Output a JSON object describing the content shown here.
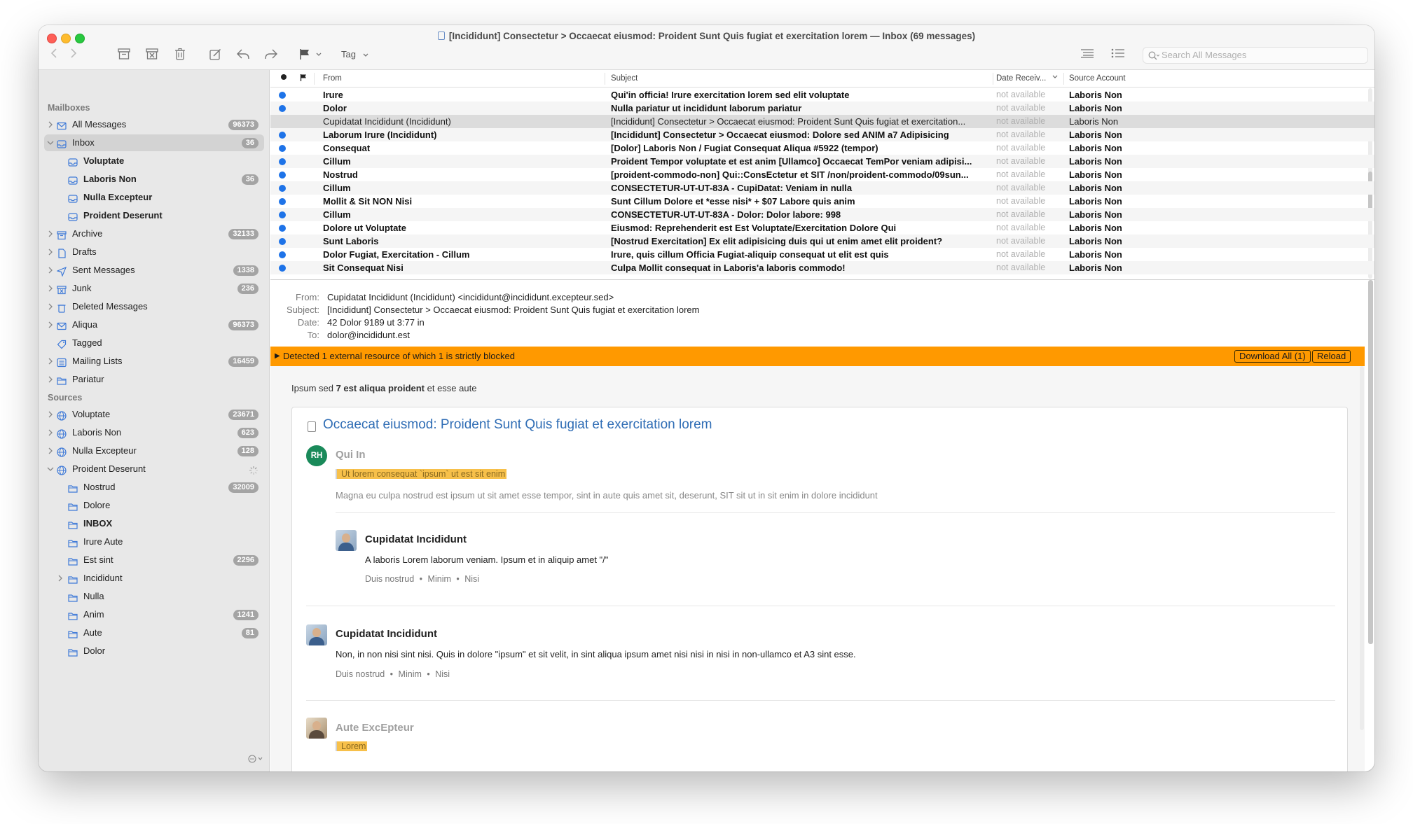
{
  "window": {
    "title": "[Incididunt] Consectetur > Occaecat eiusmod: Proident Sunt Quis fugiat et exercitation lorem — Inbox (69 messages)"
  },
  "toolbar": {
    "tag_label": "Tag",
    "search_placeholder": "Search All Messages",
    "icons": [
      "back-icon",
      "forward-icon",
      "archive-icon",
      "junk-icon",
      "trash-icon",
      "compose-icon",
      "reply-icon",
      "forward-arrow-icon",
      "flag-icon",
      "chevron-down-icon",
      "list-compact-icon",
      "list-icon",
      "search-icon"
    ]
  },
  "sidebar": {
    "mailboxes_header": "Mailboxes",
    "sources_header": "Sources",
    "mailboxes": [
      {
        "label": "All Messages",
        "badge": "96373",
        "icon": "envelope-icon",
        "chev": "right",
        "bold": false,
        "indent": 0
      },
      {
        "label": "Inbox",
        "badge": "36",
        "icon": "inbox-icon",
        "chev": "down",
        "bold": false,
        "indent": 0,
        "selected": true
      },
      {
        "label": "Voluptate",
        "badge": "",
        "icon": "inbox-icon",
        "chev": "",
        "bold": true,
        "indent": 1
      },
      {
        "label": "Laboris Non",
        "badge": "36",
        "icon": "inbox-icon",
        "chev": "",
        "bold": true,
        "indent": 1
      },
      {
        "label": "Nulla Excepteur",
        "badge": "",
        "icon": "inbox-icon",
        "chev": "",
        "bold": true,
        "indent": 1
      },
      {
        "label": "Proident Deserunt",
        "badge": "",
        "icon": "inbox-icon",
        "chev": "",
        "bold": true,
        "indent": 1
      },
      {
        "label": "Archive",
        "badge": "32133",
        "icon": "archive-icon",
        "chev": "right",
        "bold": false,
        "indent": 0
      },
      {
        "label": "Drafts",
        "badge": "",
        "icon": "draft-icon",
        "chev": "right",
        "bold": false,
        "indent": 0
      },
      {
        "label": "Sent Messages",
        "badge": "1338",
        "icon": "sent-icon",
        "chev": "right",
        "bold": false,
        "indent": 0
      },
      {
        "label": "Junk",
        "badge": "236",
        "icon": "junk-icon",
        "chev": "right",
        "bold": false,
        "indent": 0
      },
      {
        "label": "Deleted Messages",
        "badge": "",
        "icon": "trash-icon",
        "chev": "right",
        "bold": false,
        "indent": 0
      },
      {
        "label": "Aliqua",
        "badge": "96373",
        "icon": "envelope-icon",
        "chev": "right",
        "bold": false,
        "indent": 0
      },
      {
        "label": "Tagged",
        "badge": "",
        "icon": "tag-icon",
        "chev": "",
        "bold": false,
        "indent": 0
      },
      {
        "label": "Mailing Lists",
        "badge": "16459",
        "icon": "list-icon",
        "chev": "right",
        "bold": false,
        "indent": 0
      },
      {
        "label": "Pariatur",
        "badge": "",
        "icon": "folder-icon",
        "chev": "right",
        "bold": false,
        "indent": 0
      }
    ],
    "sources": [
      {
        "label": "Voluptate",
        "badge": "23671",
        "icon": "globe-icon",
        "chev": "right",
        "bold": false,
        "indent": 0
      },
      {
        "label": "Laboris Non",
        "badge": "623",
        "icon": "globe-icon",
        "chev": "right",
        "bold": false,
        "indent": 0
      },
      {
        "label": "Nulla Excepteur",
        "badge": "128",
        "icon": "globe-icon",
        "chev": "right",
        "bold": false,
        "indent": 0
      },
      {
        "label": "Proident Deserunt",
        "badge": "",
        "icon": "globe-icon",
        "chev": "down",
        "bold": false,
        "indent": 0,
        "spinner": true
      },
      {
        "label": "Nostrud",
        "badge": "32009",
        "icon": "folder-icon",
        "chev": "",
        "bold": false,
        "indent": 1
      },
      {
        "label": "Dolore",
        "badge": "",
        "icon": "folder-icon",
        "chev": "",
        "bold": false,
        "indent": 1
      },
      {
        "label": "INBOX",
        "badge": "",
        "icon": "folder-icon",
        "chev": "",
        "bold": true,
        "indent": 1
      },
      {
        "label": "Irure Aute",
        "badge": "",
        "icon": "folder-icon",
        "chev": "",
        "bold": false,
        "indent": 1
      },
      {
        "label": "Est sint",
        "badge": "2296",
        "icon": "folder-icon",
        "chev": "",
        "bold": false,
        "indent": 1
      },
      {
        "label": "Incididunt",
        "badge": "",
        "icon": "folder-icon",
        "chev": "right",
        "bold": false,
        "indent": 1
      },
      {
        "label": "Nulla",
        "badge": "",
        "icon": "folder-icon",
        "chev": "",
        "bold": false,
        "indent": 1
      },
      {
        "label": "Anim",
        "badge": "1241",
        "icon": "folder-icon",
        "chev": "",
        "bold": false,
        "indent": 1
      },
      {
        "label": "Aute",
        "badge": "81",
        "icon": "folder-icon",
        "chev": "",
        "bold": false,
        "indent": 1
      },
      {
        "label": "Dolor",
        "badge": "",
        "icon": "folder-icon",
        "chev": "",
        "bold": false,
        "indent": 1
      }
    ]
  },
  "list": {
    "columns": {
      "from": "From",
      "subject": "Subject",
      "date": "Date Receiv...",
      "account": "Source Account"
    },
    "rows": [
      {
        "from": "Irure",
        "subject": "Qui'in officia! Irure exercitation lorem sed elit voluptate",
        "date": "not available",
        "account": "Laboris Non",
        "unread": true
      },
      {
        "from": "Dolor",
        "subject": "Nulla pariatur ut incididunt laborum pariatur",
        "date": "not available",
        "account": "Laboris Non",
        "unread": true
      },
      {
        "from": "Cupidatat Incididunt (Incididunt)",
        "subject": "[Incididunt] Consectetur > Occaecat eiusmod: Proident Sunt Quis fugiat et exercitation...",
        "date": "not available",
        "account": "Laboris Non",
        "unread": false,
        "selected": true
      },
      {
        "from": "Laborum Irure (Incididunt)",
        "subject": "[Incididunt] Consectetur > Occaecat eiusmod: Dolore sed ANIM a7 Adipisicing",
        "date": "not available",
        "account": "Laboris Non",
        "unread": true
      },
      {
        "from": "Consequat",
        "subject": "[Dolor] Laboris Non / Fugiat Consequat Aliqua #5922 (tempor)",
        "date": "not available",
        "account": "Laboris Non",
        "unread": true
      },
      {
        "from": "Cillum",
        "subject": "Proident Tempor voluptate et est anim [Ullamco] Occaecat TemPor veniam adipisi...",
        "date": "not available",
        "account": "Laboris Non",
        "unread": true
      },
      {
        "from": "Nostrud",
        "subject": "[proident-commodo-non] Qui::ConsEctetur et SIT /non/proident-commodo/09sun...",
        "date": "not available",
        "account": "Laboris Non",
        "unread": true
      },
      {
        "from": "Cillum",
        "subject": "CONSECTETUR-UT-UT-83A - CupiDatat: Veniam in nulla",
        "date": "not available",
        "account": "Laboris Non",
        "unread": true
      },
      {
        "from": "Mollit & Sit NON Nisi",
        "subject": "Sunt Cillum Dolore et *esse nisi* + $07 Labore quis anim",
        "date": "not available",
        "account": "Laboris Non",
        "unread": true
      },
      {
        "from": "Cillum",
        "subject": "CONSECTETUR-UT-UT-83A - Dolor: Dolor labore: 998",
        "date": "not available",
        "account": "Laboris Non",
        "unread": true
      },
      {
        "from": "Dolore ut Voluptate",
        "subject": "Eiusmod: Reprehenderit est Est Voluptate/Exercitation Dolore Qui",
        "date": "not available",
        "account": "Laboris Non",
        "unread": true
      },
      {
        "from": "Sunt Laboris",
        "subject": "[Nostrud Exercitation] Ex elit adipisicing duis qui ut enim amet elit proident?",
        "date": "not available",
        "account": "Laboris Non",
        "unread": true
      },
      {
        "from": "Dolor Fugiat, Exercitation - Cillum",
        "subject": "Irure, quis cillum Officia Fugiat-aliquip consequat ut elit est quis",
        "date": "not available",
        "account": "Laboris Non",
        "unread": true
      },
      {
        "from": "Sit Consequat Nisi",
        "subject": "Culpa Mollit consequat in Laboris'a laboris commodo!",
        "date": "not available",
        "account": "Laboris Non",
        "unread": true
      }
    ]
  },
  "message": {
    "from_label": "From:",
    "from": "Cupidatat Incididunt (Incididunt) <incididunt@incididunt.excepteur.sed>",
    "subject_label": "Subject:",
    "subject": "[Incididunt] Consectetur > Occaecat eiusmod: Proident Sunt Quis fugiat et exercitation lorem",
    "date_label": "Date:",
    "date": "42 Dolor 9189 ut 3:77 in",
    "to_label": "To:",
    "to": "dolor@incididunt.est"
  },
  "banner": {
    "text": "Detected 1 external resource of which 1 is strictly blocked",
    "download_all": "Download All (1)",
    "reload": "Reload",
    "color": "#ff9900"
  },
  "body": {
    "intro_pre": "Ipsum sed ",
    "intro_bold": "7 est aliqua proident",
    "intro_post": " et esse aute",
    "card_title": "Occaecat eiusmod: Proident Sunt Quis fugiat et exercitation lorem",
    "comments": [
      {
        "avatar_initials": "RH",
        "author": "Qui In",
        "quote": "Ut lorem consequat `ipsum` ut est sit enim",
        "text": "Magna eu culpa nostrud est ipsum ut sit amet esse tempor, sint in aute quis amet sit, deserunt, SIT sit ut in sit enim in dolore incididunt"
      },
      {
        "author": "Cupidatat Incididunt",
        "text": "A laboris Lorem laborum veniam. Ipsum et in aliquip amet \"/\"",
        "meta": [
          "Duis nostrud",
          "Minim",
          "Nisi"
        ]
      },
      {
        "author": "Cupidatat Incididunt",
        "text": "Non, in non nisi sint nisi. Quis in dolore \"ipsum\" et sit velit, in sint aliqua ipsum amet nisi nisi in nisi in non-ullamco et A3 sint esse.",
        "meta": [
          "Duis nostrud",
          "Minim",
          "Nisi"
        ]
      },
      {
        "author": "Aute ExcEpteur",
        "quote": "Lorem"
      }
    ],
    "bullet": "•"
  }
}
